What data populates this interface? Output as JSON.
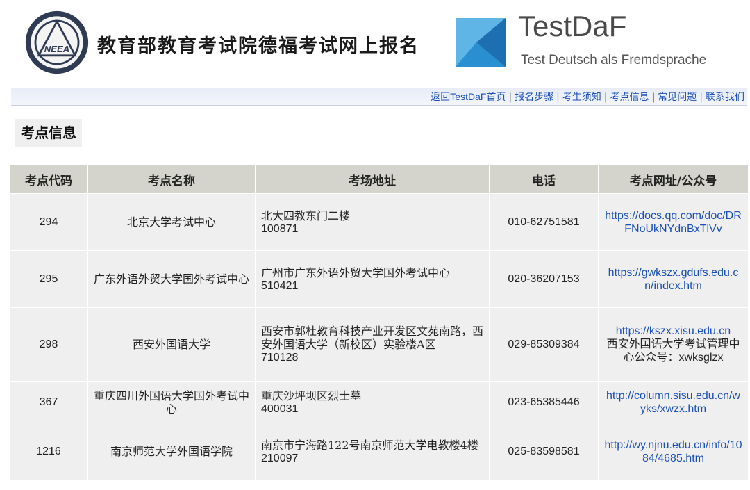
{
  "header": {
    "neea_logo_text": "NEEA",
    "title": "教育部教育考试院德福考试网上报名",
    "testdaf_name": "TestDaF",
    "testdaf_sub": "Test Deutsch als Fremdsprache"
  },
  "nav": {
    "items": [
      {
        "prefix": "返回",
        "label": "TestDaF",
        "suffix": "首页"
      },
      {
        "label": "报名步骤"
      },
      {
        "label": "考生须知"
      },
      {
        "label": "考点信息"
      },
      {
        "label": "常见问题"
      },
      {
        "label": "联系我们"
      }
    ]
  },
  "section_title": "考点信息",
  "table": {
    "headers": [
      "考点代码",
      "考点名称",
      "考场地址",
      "电话",
      "考点网址/公众号"
    ],
    "rows": [
      {
        "code": "294",
        "name": "北京大学考试中心",
        "address": "北大四教东门二楼",
        "zip": "100871",
        "phone": "010-62751581",
        "url": "https://docs.qq.com/doc/DRFNoUkNYdnBxTlVv",
        "note": ""
      },
      {
        "code": "295",
        "name": "广东外语外贸大学国外考试中心",
        "address": "广州市广东外语外贸大学国外考试中心",
        "zip": "510421",
        "phone": "020-36207153",
        "url": "https://gwkszx.gdufs.edu.cn/index.htm",
        "note": ""
      },
      {
        "code": "298",
        "name": "西安外国语大学",
        "address": "西安市郭杜教育科技产业开发区文苑南路，西安外国语大学（新校区）实验楼A区",
        "zip": "710128",
        "phone": "029-85309384",
        "url": "https://kszx.xisu.edu.cn",
        "note": "西安外国语大学考试管理中心公众号：xwksglzx"
      },
      {
        "code": "367",
        "name": "重庆四川外国语大学国外考试中心",
        "address": "重庆沙坪坝区烈士墓",
        "zip": "400031",
        "phone": "023-65385446",
        "url": "http://column.sisu.edu.cn/wyks/xwzx.htm",
        "note": ""
      },
      {
        "code": "1216",
        "name": "南京师范大学外国语学院",
        "address": "南京市宁海路122号南京师范大学电教楼4楼",
        "zip": "210097",
        "phone": "025-83598581",
        "url": "http://wy.njnu.edu.cn/info/1084/4685.htm",
        "note": ""
      }
    ]
  }
}
